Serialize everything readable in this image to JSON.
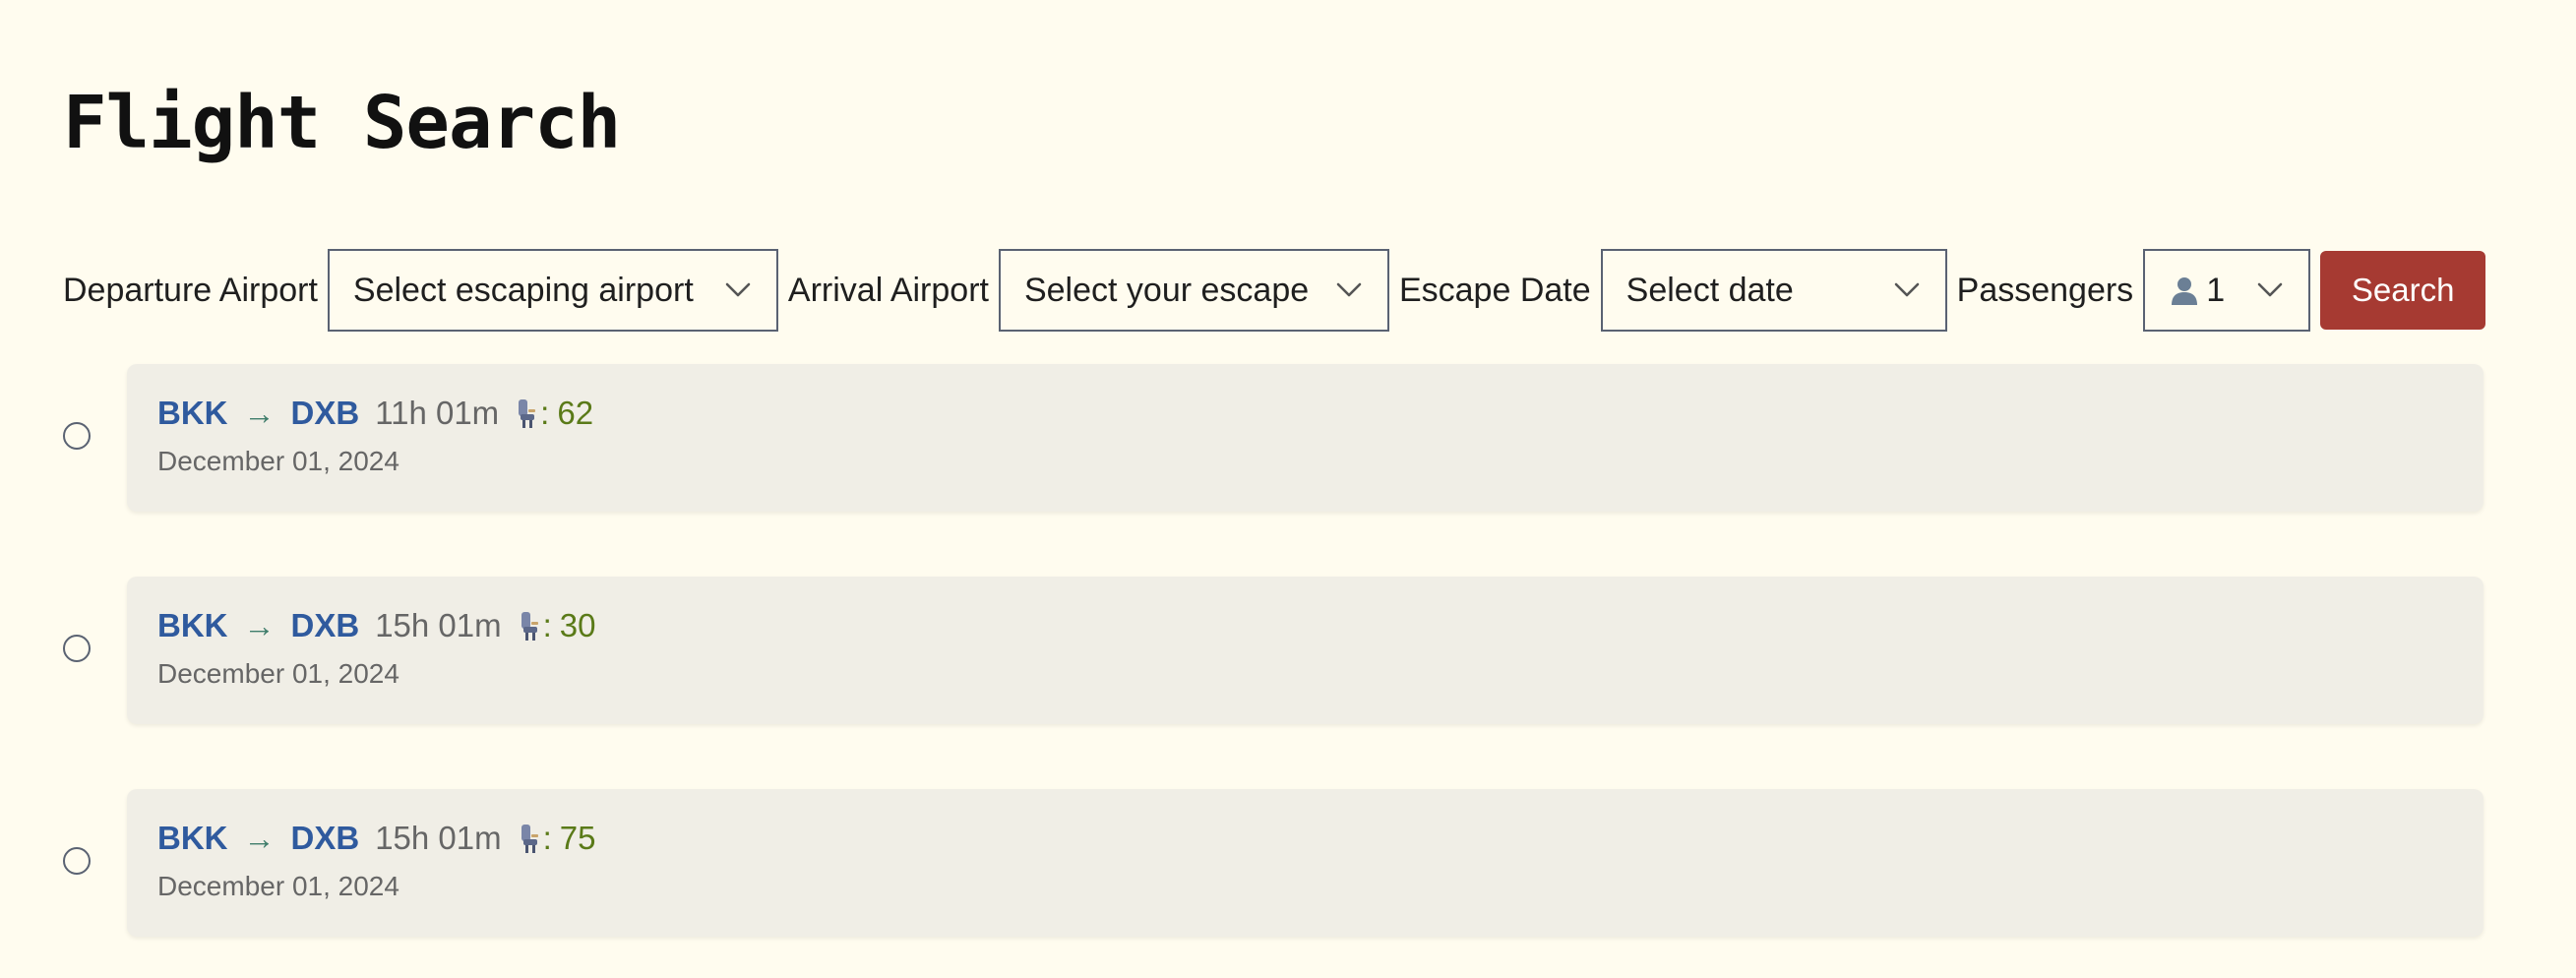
{
  "page": {
    "title": "Flight Search"
  },
  "search": {
    "departure_label": "Departure Airport",
    "departure_value": "Select escaping airport",
    "arrival_label": "Arrival Airport",
    "arrival_value": "Select your escape",
    "date_label": "Escape Date",
    "date_value": "Select date",
    "passengers_label": "Passengers",
    "passengers_value": "1",
    "passengers_icon": "person-icon",
    "button_label": "Search"
  },
  "flights": [
    {
      "from": "BKK",
      "arrow": "→",
      "to": "DXB",
      "duration": "11h 01m",
      "seat_icon": "seat-icon",
      "seats": "62",
      "date": "December 01, 2024"
    },
    {
      "from": "BKK",
      "arrow": "→",
      "to": "DXB",
      "duration": "15h 01m",
      "seat_icon": "seat-icon",
      "seats": "30",
      "date": "December 01, 2024"
    },
    {
      "from": "BKK",
      "arrow": "→",
      "to": "DXB",
      "duration": "15h 01m",
      "seat_icon": "seat-icon",
      "seats": "75",
      "date": "December 01, 2024"
    }
  ],
  "colors": {
    "background": "#fffcef",
    "card": "#f0eee6",
    "airport_code": "#2f5a9e",
    "arrow": "#3f7d6b",
    "seat_count": "#5a7a18",
    "search_button": "#a63a32"
  }
}
